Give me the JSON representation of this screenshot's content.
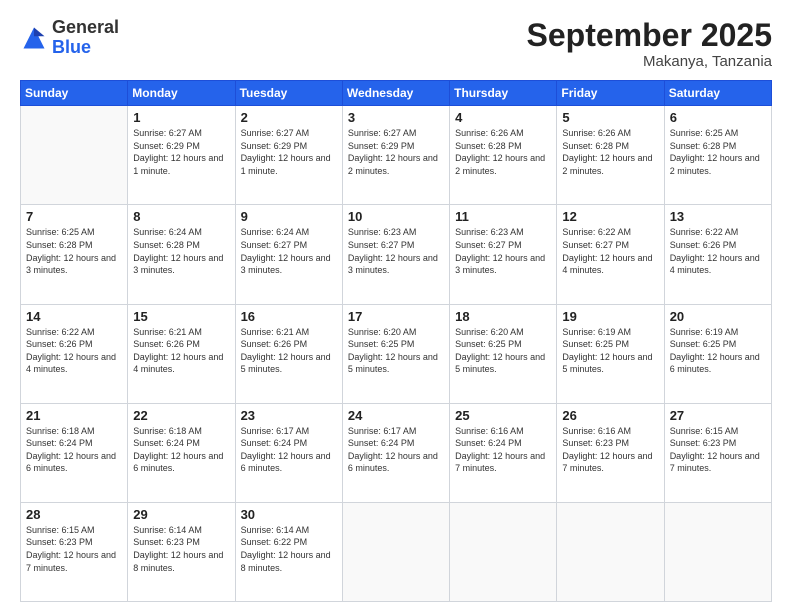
{
  "header": {
    "logo_general": "General",
    "logo_blue": "Blue",
    "month_title": "September 2025",
    "subtitle": "Makanya, Tanzania"
  },
  "weekdays": [
    "Sunday",
    "Monday",
    "Tuesday",
    "Wednesday",
    "Thursday",
    "Friday",
    "Saturday"
  ],
  "weeks": [
    [
      {
        "day": "",
        "info": ""
      },
      {
        "day": "1",
        "info": "Sunrise: 6:27 AM\nSunset: 6:29 PM\nDaylight: 12 hours\nand 1 minute."
      },
      {
        "day": "2",
        "info": "Sunrise: 6:27 AM\nSunset: 6:29 PM\nDaylight: 12 hours\nand 1 minute."
      },
      {
        "day": "3",
        "info": "Sunrise: 6:27 AM\nSunset: 6:29 PM\nDaylight: 12 hours\nand 2 minutes."
      },
      {
        "day": "4",
        "info": "Sunrise: 6:26 AM\nSunset: 6:28 PM\nDaylight: 12 hours\nand 2 minutes."
      },
      {
        "day": "5",
        "info": "Sunrise: 6:26 AM\nSunset: 6:28 PM\nDaylight: 12 hours\nand 2 minutes."
      },
      {
        "day": "6",
        "info": "Sunrise: 6:25 AM\nSunset: 6:28 PM\nDaylight: 12 hours\nand 2 minutes."
      }
    ],
    [
      {
        "day": "7",
        "info": "Sunrise: 6:25 AM\nSunset: 6:28 PM\nDaylight: 12 hours\nand 3 minutes."
      },
      {
        "day": "8",
        "info": "Sunrise: 6:24 AM\nSunset: 6:28 PM\nDaylight: 12 hours\nand 3 minutes."
      },
      {
        "day": "9",
        "info": "Sunrise: 6:24 AM\nSunset: 6:27 PM\nDaylight: 12 hours\nand 3 minutes."
      },
      {
        "day": "10",
        "info": "Sunrise: 6:23 AM\nSunset: 6:27 PM\nDaylight: 12 hours\nand 3 minutes."
      },
      {
        "day": "11",
        "info": "Sunrise: 6:23 AM\nSunset: 6:27 PM\nDaylight: 12 hours\nand 3 minutes."
      },
      {
        "day": "12",
        "info": "Sunrise: 6:22 AM\nSunset: 6:27 PM\nDaylight: 12 hours\nand 4 minutes."
      },
      {
        "day": "13",
        "info": "Sunrise: 6:22 AM\nSunset: 6:26 PM\nDaylight: 12 hours\nand 4 minutes."
      }
    ],
    [
      {
        "day": "14",
        "info": "Sunrise: 6:22 AM\nSunset: 6:26 PM\nDaylight: 12 hours\nand 4 minutes."
      },
      {
        "day": "15",
        "info": "Sunrise: 6:21 AM\nSunset: 6:26 PM\nDaylight: 12 hours\nand 4 minutes."
      },
      {
        "day": "16",
        "info": "Sunrise: 6:21 AM\nSunset: 6:26 PM\nDaylight: 12 hours\nand 5 minutes."
      },
      {
        "day": "17",
        "info": "Sunrise: 6:20 AM\nSunset: 6:25 PM\nDaylight: 12 hours\nand 5 minutes."
      },
      {
        "day": "18",
        "info": "Sunrise: 6:20 AM\nSunset: 6:25 PM\nDaylight: 12 hours\nand 5 minutes."
      },
      {
        "day": "19",
        "info": "Sunrise: 6:19 AM\nSunset: 6:25 PM\nDaylight: 12 hours\nand 5 minutes."
      },
      {
        "day": "20",
        "info": "Sunrise: 6:19 AM\nSunset: 6:25 PM\nDaylight: 12 hours\nand 6 minutes."
      }
    ],
    [
      {
        "day": "21",
        "info": "Sunrise: 6:18 AM\nSunset: 6:24 PM\nDaylight: 12 hours\nand 6 minutes."
      },
      {
        "day": "22",
        "info": "Sunrise: 6:18 AM\nSunset: 6:24 PM\nDaylight: 12 hours\nand 6 minutes."
      },
      {
        "day": "23",
        "info": "Sunrise: 6:17 AM\nSunset: 6:24 PM\nDaylight: 12 hours\nand 6 minutes."
      },
      {
        "day": "24",
        "info": "Sunrise: 6:17 AM\nSunset: 6:24 PM\nDaylight: 12 hours\nand 6 minutes."
      },
      {
        "day": "25",
        "info": "Sunrise: 6:16 AM\nSunset: 6:24 PM\nDaylight: 12 hours\nand 7 minutes."
      },
      {
        "day": "26",
        "info": "Sunrise: 6:16 AM\nSunset: 6:23 PM\nDaylight: 12 hours\nand 7 minutes."
      },
      {
        "day": "27",
        "info": "Sunrise: 6:15 AM\nSunset: 6:23 PM\nDaylight: 12 hours\nand 7 minutes."
      }
    ],
    [
      {
        "day": "28",
        "info": "Sunrise: 6:15 AM\nSunset: 6:23 PM\nDaylight: 12 hours\nand 7 minutes."
      },
      {
        "day": "29",
        "info": "Sunrise: 6:14 AM\nSunset: 6:23 PM\nDaylight: 12 hours\nand 8 minutes."
      },
      {
        "day": "30",
        "info": "Sunrise: 6:14 AM\nSunset: 6:22 PM\nDaylight: 12 hours\nand 8 minutes."
      },
      {
        "day": "",
        "info": ""
      },
      {
        "day": "",
        "info": ""
      },
      {
        "day": "",
        "info": ""
      },
      {
        "day": "",
        "info": ""
      }
    ]
  ]
}
